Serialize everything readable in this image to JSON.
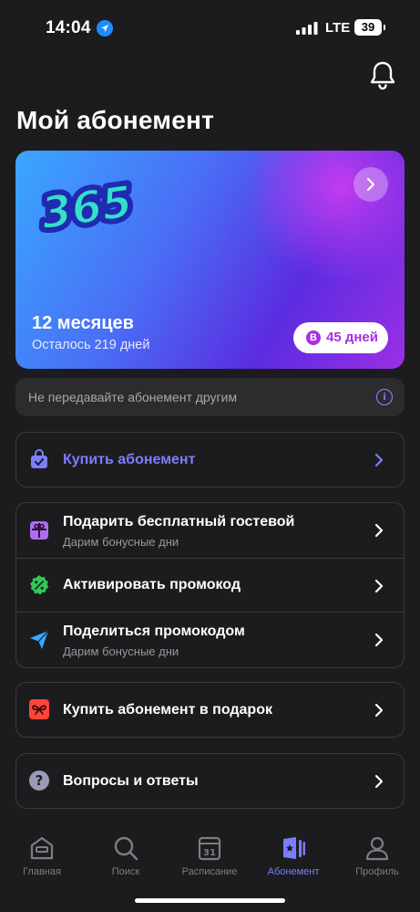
{
  "status_bar": {
    "time": "14:04",
    "network": "LTE",
    "battery": "39"
  },
  "page_title": "Мой абонемент",
  "card": {
    "title": "12 месяцев",
    "subtitle": "Осталось 219 дней",
    "bonus_badge": "В",
    "bonus": "45 дней",
    "logo_text": "365"
  },
  "notice": {
    "text": "Не передавайте абонемент другим"
  },
  "menu": {
    "buy": {
      "title": "Купить абонемент"
    },
    "gift_guest": {
      "title": "Подарить бесплатный гостевой",
      "subtitle": "Дарим бонусные дни"
    },
    "activate_promo": {
      "title": "Активировать промокод"
    },
    "share_promo": {
      "title": "Поделиться промокодом",
      "subtitle": "Дарим бонусные дни"
    },
    "buy_gift": {
      "title": "Купить абонемент в подарок"
    },
    "faq": {
      "title": "Вопросы и ответы"
    }
  },
  "tabs": [
    {
      "label": "Главная",
      "icon": "home-icon"
    },
    {
      "label": "Поиск",
      "icon": "search-icon"
    },
    {
      "label": "Расписание",
      "icon": "calendar-icon",
      "date": "31"
    },
    {
      "label": "Абонемент",
      "icon": "membership-card-icon",
      "active": true
    },
    {
      "label": "Профиль",
      "icon": "profile-icon"
    }
  ],
  "colors": {
    "accent": "#7b7dff",
    "background": "#1c1c1e",
    "bonus": "#a530e0"
  }
}
